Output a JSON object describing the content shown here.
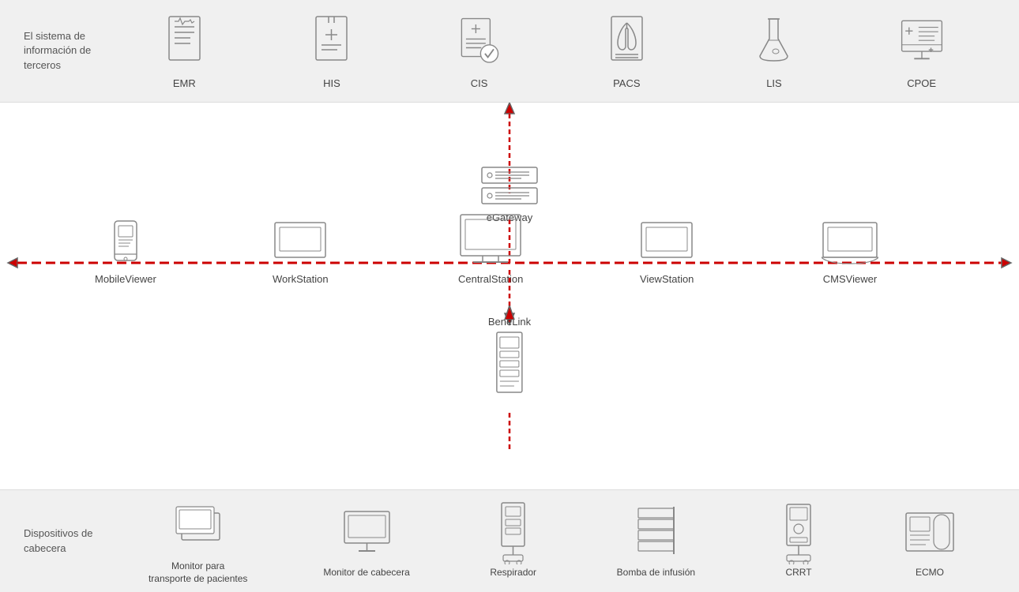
{
  "topSection": {
    "label": "El sistema de información de terceros",
    "systems": [
      {
        "id": "emr",
        "name": "EMR"
      },
      {
        "id": "his",
        "name": "HIS"
      },
      {
        "id": "cis",
        "name": "CIS",
        "highlighted": true
      },
      {
        "id": "pacs",
        "name": "PACS"
      },
      {
        "id": "lis",
        "name": "LIS"
      },
      {
        "id": "cpoe",
        "name": "CPOE"
      }
    ]
  },
  "middleSection": {
    "egateway": {
      "name": "eGateway"
    },
    "networkDevices": [
      {
        "id": "mobile-viewer",
        "name": "MobileViewer"
      },
      {
        "id": "workstation",
        "name": "WorkStation"
      },
      {
        "id": "central-station",
        "name": "CentralStation"
      },
      {
        "id": "view-station",
        "name": "ViewStation"
      },
      {
        "id": "cms-viewer",
        "name": "CMSViewer"
      }
    ],
    "benelink": {
      "name": "BeneLink"
    }
  },
  "bottomSection": {
    "label": "Dispositivos de cabecera",
    "devices": [
      {
        "id": "monitor-transport",
        "name": "Monitor para\ntransporte de pacientes"
      },
      {
        "id": "monitor-cabecera",
        "name": "Monitor de cabecera"
      },
      {
        "id": "respirador",
        "name": "Respirador"
      },
      {
        "id": "bomba-infusion",
        "name": "Bomba de infusión"
      },
      {
        "id": "crrt",
        "name": "CRRT"
      },
      {
        "id": "ecmo",
        "name": "ECMO"
      }
    ]
  }
}
